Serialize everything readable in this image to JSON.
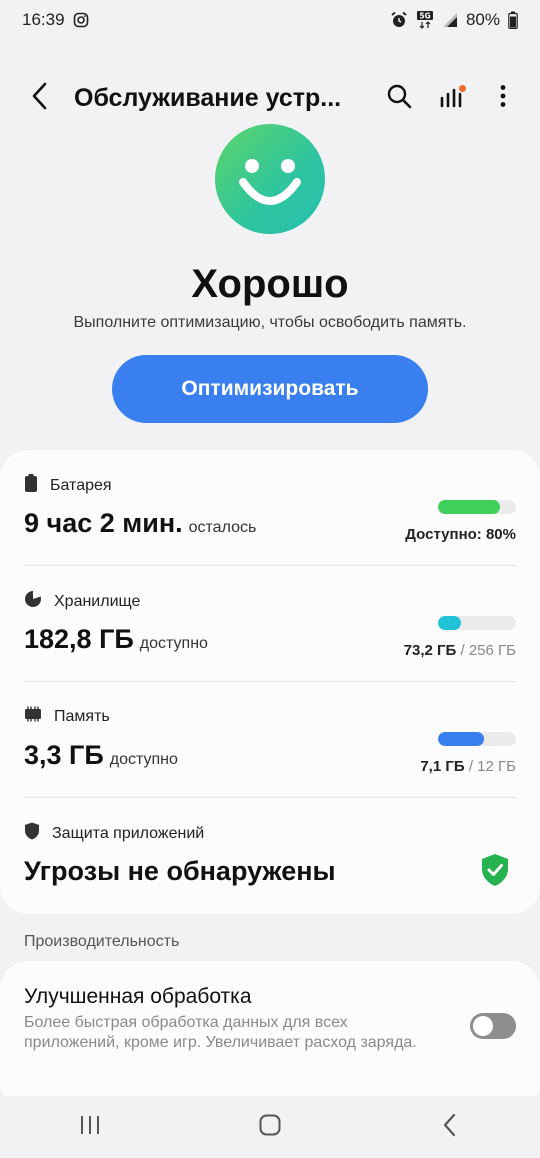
{
  "status_bar": {
    "time": "16:39",
    "battery": "80%",
    "icons": [
      "instagram-icon",
      "alarm-icon",
      "5g-icon",
      "signal-icon",
      "battery-icon"
    ]
  },
  "app_bar": {
    "title": "Обслуживание устр...",
    "icons": [
      "back-arrow-icon",
      "search-icon",
      "bar-chart-icon",
      "more-vertical-icon"
    ]
  },
  "summary": {
    "status_title": "Хорошо",
    "subtitle": "Выполните оптимизацию, чтобы освободить память.",
    "optimize_button": "Оптимизировать"
  },
  "cards": {
    "battery": {
      "label": "Батарея",
      "value": "9 час 2 мин.",
      "suffix": "осталось",
      "meta": "Доступно: 80%",
      "fill": 0.8,
      "color": "#3ed05a"
    },
    "storage": {
      "label": "Хранилище",
      "value": "182,8 ГБ",
      "suffix": "доступно",
      "used": "73,2 ГБ",
      "total": "256 ГБ",
      "fill": 0.29,
      "color": "#22c3d8"
    },
    "memory": {
      "label": "Память",
      "value": "3,3 ГБ",
      "suffix": "доступно",
      "used": "7,1 ГБ",
      "total": "12 ГБ",
      "fill": 0.59,
      "color": "#3a7ff0"
    },
    "app_protection": {
      "label": "Защита приложений",
      "value": "Угрозы не обнаружены",
      "color": "#26b34f"
    }
  },
  "performance": {
    "section_title": "Производительность",
    "item_title": "Улучшенная обработка",
    "item_desc": "Более быстрая обработка данных для всех приложений, кроме игр. Увеличивает расход заряда.",
    "toggle_on": false
  },
  "colors": {
    "accent": "#3a7ff0",
    "background": "#f2f2f4",
    "card": "#fcfcfc"
  }
}
